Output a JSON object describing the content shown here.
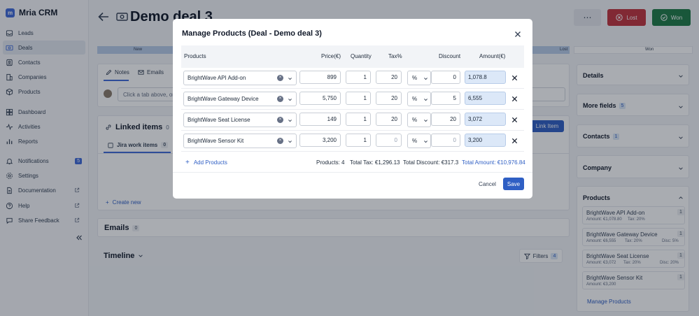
{
  "app": {
    "name": "Mria CRM"
  },
  "sidebar": {
    "items": [
      {
        "label": "Leads"
      },
      {
        "label": "Deals"
      },
      {
        "label": "Contacts"
      },
      {
        "label": "Companies"
      },
      {
        "label": "Products"
      },
      {
        "label": "Dashboard"
      },
      {
        "label": "Activities"
      },
      {
        "label": "Reports"
      },
      {
        "label": "Notifications",
        "badge": "5"
      },
      {
        "label": "Settings"
      },
      {
        "label": "Documentation"
      },
      {
        "label": "Help"
      },
      {
        "label": "Share Feedback"
      }
    ]
  },
  "header": {
    "title": "Demo deal 3",
    "lost_label": "Lost",
    "won_label": "Won",
    "more": "⋯"
  },
  "pipeline": {
    "stage_new": "New",
    "stage_lost": "Lost",
    "stage_won": "Won"
  },
  "tabs": {
    "notes": "Notes",
    "emails": "Emails"
  },
  "composer": {
    "placeholder": "Click a tab above, or"
  },
  "linked": {
    "title": "Linked items",
    "count": "0",
    "link_item": "Link Item",
    "jira_tab": "Jira work items",
    "jira_count": "0",
    "create_new": "Create new"
  },
  "emails_section": {
    "title": "Emails",
    "count": "0"
  },
  "timeline": {
    "title": "Timeline",
    "filters": "Filters",
    "filters_count": "4"
  },
  "right": {
    "details": "Details",
    "more_fields": "More fields",
    "more_fields_count": "5",
    "contacts": "Contacts",
    "contacts_count": "1",
    "company": "Company",
    "products_title": "Products",
    "products": [
      {
        "name": "BrightWave API Add-on",
        "amount": "Amount: €1,078.80",
        "tax": "Tax: 20%",
        "qty": "1",
        "disc": ""
      },
      {
        "name": "BrightWave Gateway Device",
        "amount": "Amount: €6,555",
        "tax": "Tax: 20%",
        "qty": "1",
        "disc": "Disc: 5%"
      },
      {
        "name": "BrightWave Seat License",
        "amount": "Amount: €3,072",
        "tax": "Tax: 20%",
        "qty": "1",
        "disc": "Disc: 20%"
      },
      {
        "name": "BrightWave Sensor Kit",
        "amount": "Amount: €3,200",
        "tax": "",
        "qty": "1",
        "disc": ""
      }
    ],
    "manage_products": "Manage Products"
  },
  "modal": {
    "title": "Manage Products (Deal - Demo deal 3)",
    "columns": {
      "products": "Products",
      "price": "Price(€)",
      "quantity": "Quantity",
      "tax": "Tax%",
      "discount": "Discount",
      "amount": "Amount(€)"
    },
    "rows": [
      {
        "product": "BrightWave API Add-on",
        "price": "899",
        "qty": "1",
        "tax": "20",
        "disc_type": "%",
        "disc": "0",
        "amount": "1,078.8"
      },
      {
        "product": "BrightWave Gateway Device",
        "price": "5,750",
        "qty": "1",
        "tax": "20",
        "disc_type": "%",
        "disc": "5",
        "amount": "6,555"
      },
      {
        "product": "BrightWave Seat License",
        "price": "149",
        "qty": "1",
        "tax": "20",
        "disc_type": "%",
        "disc": "20",
        "amount": "3,072"
      },
      {
        "product": "BrightWave Sensor Kit",
        "price": "3,200",
        "qty": "1",
        "tax": "0",
        "disc_type": "%",
        "disc": "0",
        "amount": "3,200"
      }
    ],
    "add_products": "Add Products",
    "summary": {
      "products": "Products: 4",
      "tax": "Total Tax: €1,296.13",
      "discount": "Total Discount: €317.3",
      "amount": "Total Amount: €10,976.84"
    },
    "cancel": "Cancel",
    "save": "Save"
  },
  "colors": {
    "accent": "#3f6ad8",
    "lost": "#c0323c",
    "won": "#1f7a45",
    "amount_bg": "#dce8f8"
  }
}
